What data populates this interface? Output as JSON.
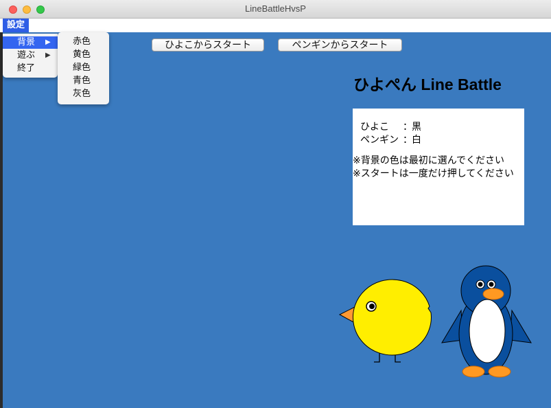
{
  "window": {
    "title": "LineBattleHvsP"
  },
  "menubar": {
    "menu_title": "設定"
  },
  "settings_menu": {
    "items": [
      {
        "label": "背景",
        "arrow": "▶"
      },
      {
        "label": "遊ぶ",
        "arrow": "▶"
      },
      {
        "label": "終了",
        "arrow": ""
      }
    ],
    "active_item": "背景"
  },
  "background_submenu": {
    "items": [
      "赤色",
      "黄色",
      "緑色",
      "青色",
      "灰色"
    ]
  },
  "buttons": {
    "start_chick": "ひよこからスタート",
    "start_penguin": "ペンギンからスタート"
  },
  "app_title": "ひよぺん Line Battle",
  "info": {
    "chick_label": "ひよこ",
    "chick_sep": "：",
    "chick_color": "黒",
    "penguin_label": "ペンギン",
    "penguin_sep": "：",
    "penguin_color": "白",
    "note1": "※背景の色は最初に選んでください",
    "note2": "※スタートは一度だけ押してください"
  },
  "colors": {
    "background": "#3a7abf",
    "chick_body": "#ffee00",
    "beak": "#ff9933",
    "penguin_body": "#0a4f9e"
  },
  "characters": [
    "chick-illustration",
    "penguin-illustration"
  ]
}
